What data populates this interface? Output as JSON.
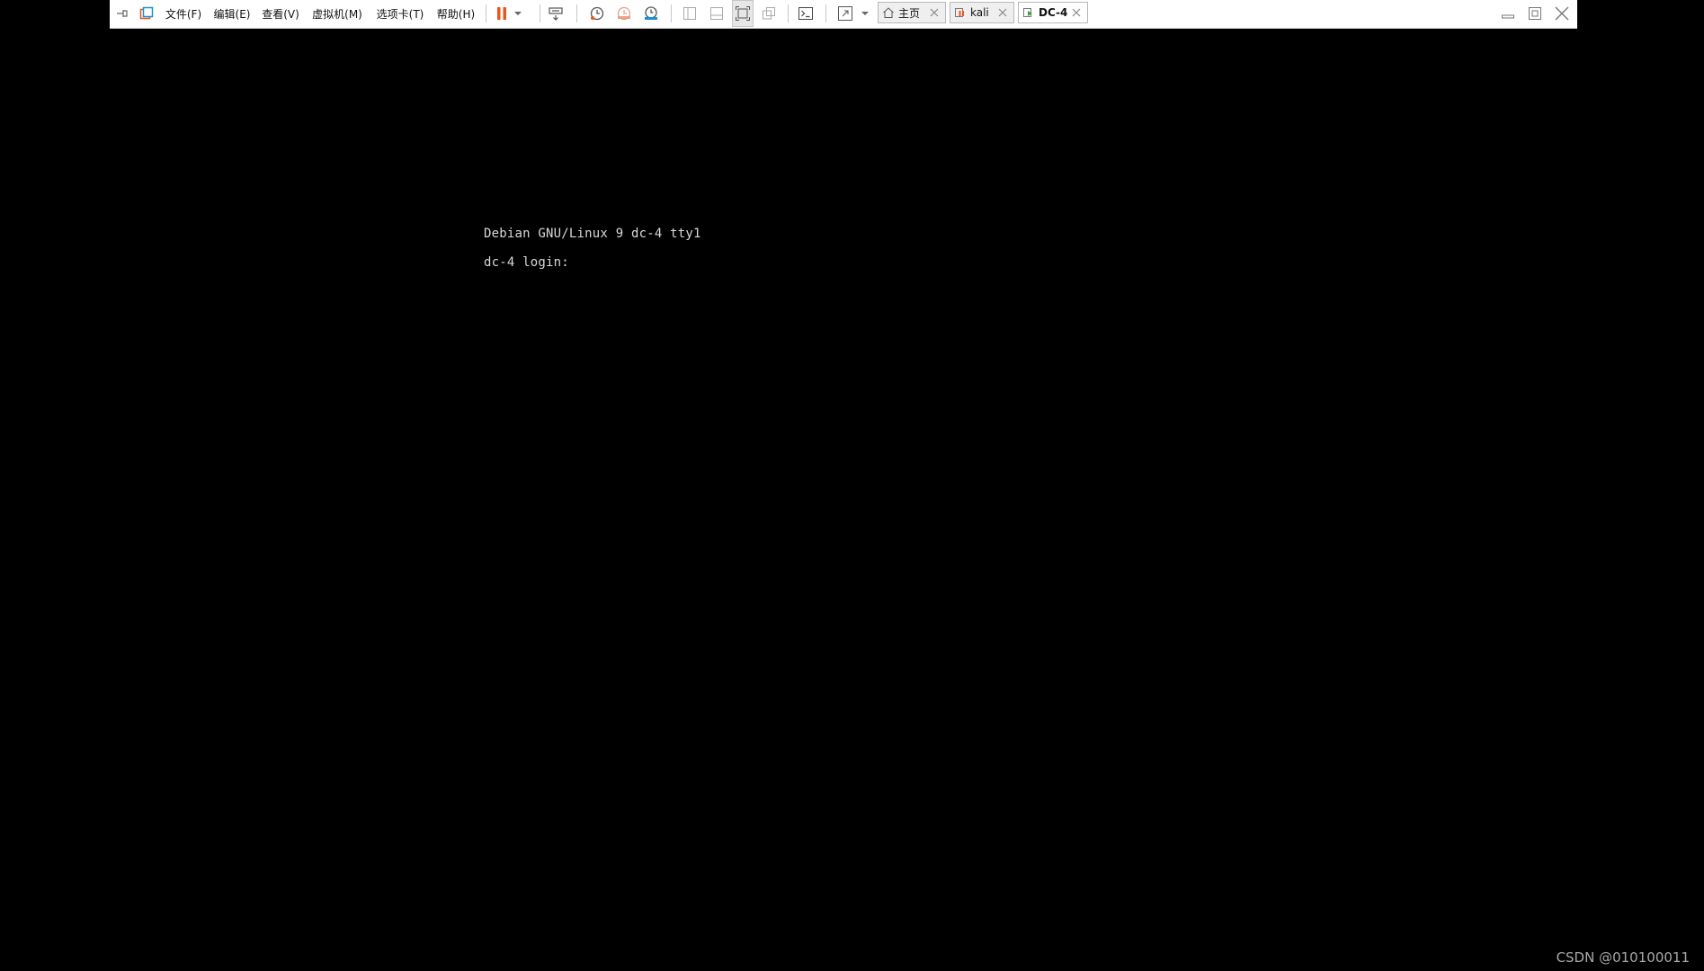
{
  "toolbar": {
    "menu": [
      {
        "label": "文件(F)"
      },
      {
        "label": "编辑(E)"
      },
      {
        "label": "查看(V)"
      },
      {
        "label": "虚拟机(M)"
      },
      {
        "label": "选项卡(T)"
      },
      {
        "label": "帮助(H)"
      }
    ],
    "icons": {
      "pin": "pin-icon",
      "library": "library-icon",
      "pause": "pause-icon",
      "dropdown": "chevron-down-icon",
      "send_keys": "send-ctrl-alt-del-icon",
      "snapshot": "snapshot-icon",
      "revert": "revert-snapshot-icon",
      "manage_snapshots": "manage-snapshots-icon",
      "console": "console-icon",
      "fullscreen": "fullscreen-icon"
    },
    "accent_color": "#e8571e"
  },
  "tabs": [
    {
      "label": "主页",
      "icon": "home-icon",
      "active": false
    },
    {
      "label": "kali",
      "icon": "vm-icon",
      "active": false
    },
    {
      "label": "DC-4",
      "icon": "vm-running-icon",
      "active": true
    }
  ],
  "window_controls": {
    "minimize": "minimize-icon",
    "restore": "restore-icon",
    "close": "close-icon"
  },
  "console": {
    "line1": "Debian GNU/Linux 9 dc-4 tty1",
    "line2": "dc-4 login: "
  },
  "watermark": "CSDN @010100011"
}
